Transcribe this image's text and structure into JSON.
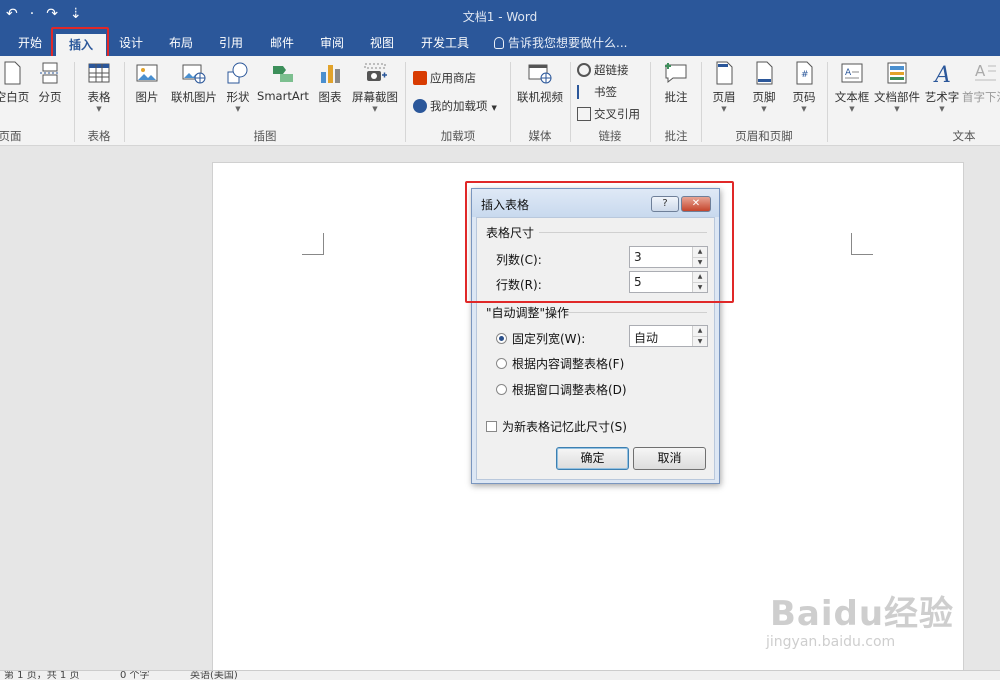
{
  "titlebar": {
    "title": "文档1 - Word",
    "qat": [
      "↶",
      "·",
      "↷",
      "⇣"
    ]
  },
  "tabs": {
    "items": [
      "开始",
      "插入",
      "设计",
      "布局",
      "引用",
      "邮件",
      "审阅",
      "视图",
      "开发工具"
    ],
    "active": "插入",
    "tellme": "告诉我您想要做什么..."
  },
  "ribbon": {
    "pages_group": {
      "blank_page": "空白页",
      "page_break": "分页",
      "label": "页面"
    },
    "table_group": {
      "table": "表格",
      "label": "表格"
    },
    "illustrations_group": {
      "picture": "图片",
      "online_picture": "联机图片",
      "shapes": "形状",
      "smartart": "SmartArt",
      "chart": "图表",
      "screenshot": "屏幕截图",
      "label": "插图"
    },
    "addins_group": {
      "store": "应用商店",
      "my_addins": "我的加载项",
      "label": "加载项"
    },
    "media_group": {
      "online_video": "联机视频",
      "label": "媒体"
    },
    "links_group": {
      "hyperlink": "超链接",
      "bookmark": "书签",
      "cross_ref": "交叉引用",
      "label": "链接"
    },
    "comments_group": {
      "comment": "批注",
      "label": "批注"
    },
    "header_footer_group": {
      "header": "页眉",
      "footer": "页脚",
      "page_number": "页码",
      "label": "页眉和页脚"
    },
    "text_group": {
      "textbox": "文本框",
      "quick_parts": "文档部件",
      "wordart": "艺术字",
      "dropcap": "首字下沉",
      "label": "文本"
    }
  },
  "dialog": {
    "title": "插入表格",
    "help": "?",
    "close": "✕",
    "table_size_label": "表格尺寸",
    "columns_label": "列数(C):",
    "columns_value": "3",
    "rows_label": "行数(R):",
    "rows_value": "5",
    "autofit_label": "\"自动调整\"操作",
    "fixed_width_label": "固定列宽(W):",
    "fixed_width_value": "自动",
    "autofit_contents_label": "根据内容调整表格(F)",
    "autofit_window_label": "根据窗口调整表格(D)",
    "remember_label": "为新表格记忆此尺寸(S)",
    "ok": "确定",
    "cancel": "取消",
    "selected_option": "fixed_width"
  },
  "statusbar": {
    "pages": "第 1 页，共 1 页",
    "words": "0 个字",
    "language": "英语(美国)"
  },
  "watermark": {
    "brand": "Baidu经验",
    "url": "jingyan.baidu.com"
  },
  "colors": {
    "accent": "#2b579a",
    "highlight": "#e02828"
  }
}
